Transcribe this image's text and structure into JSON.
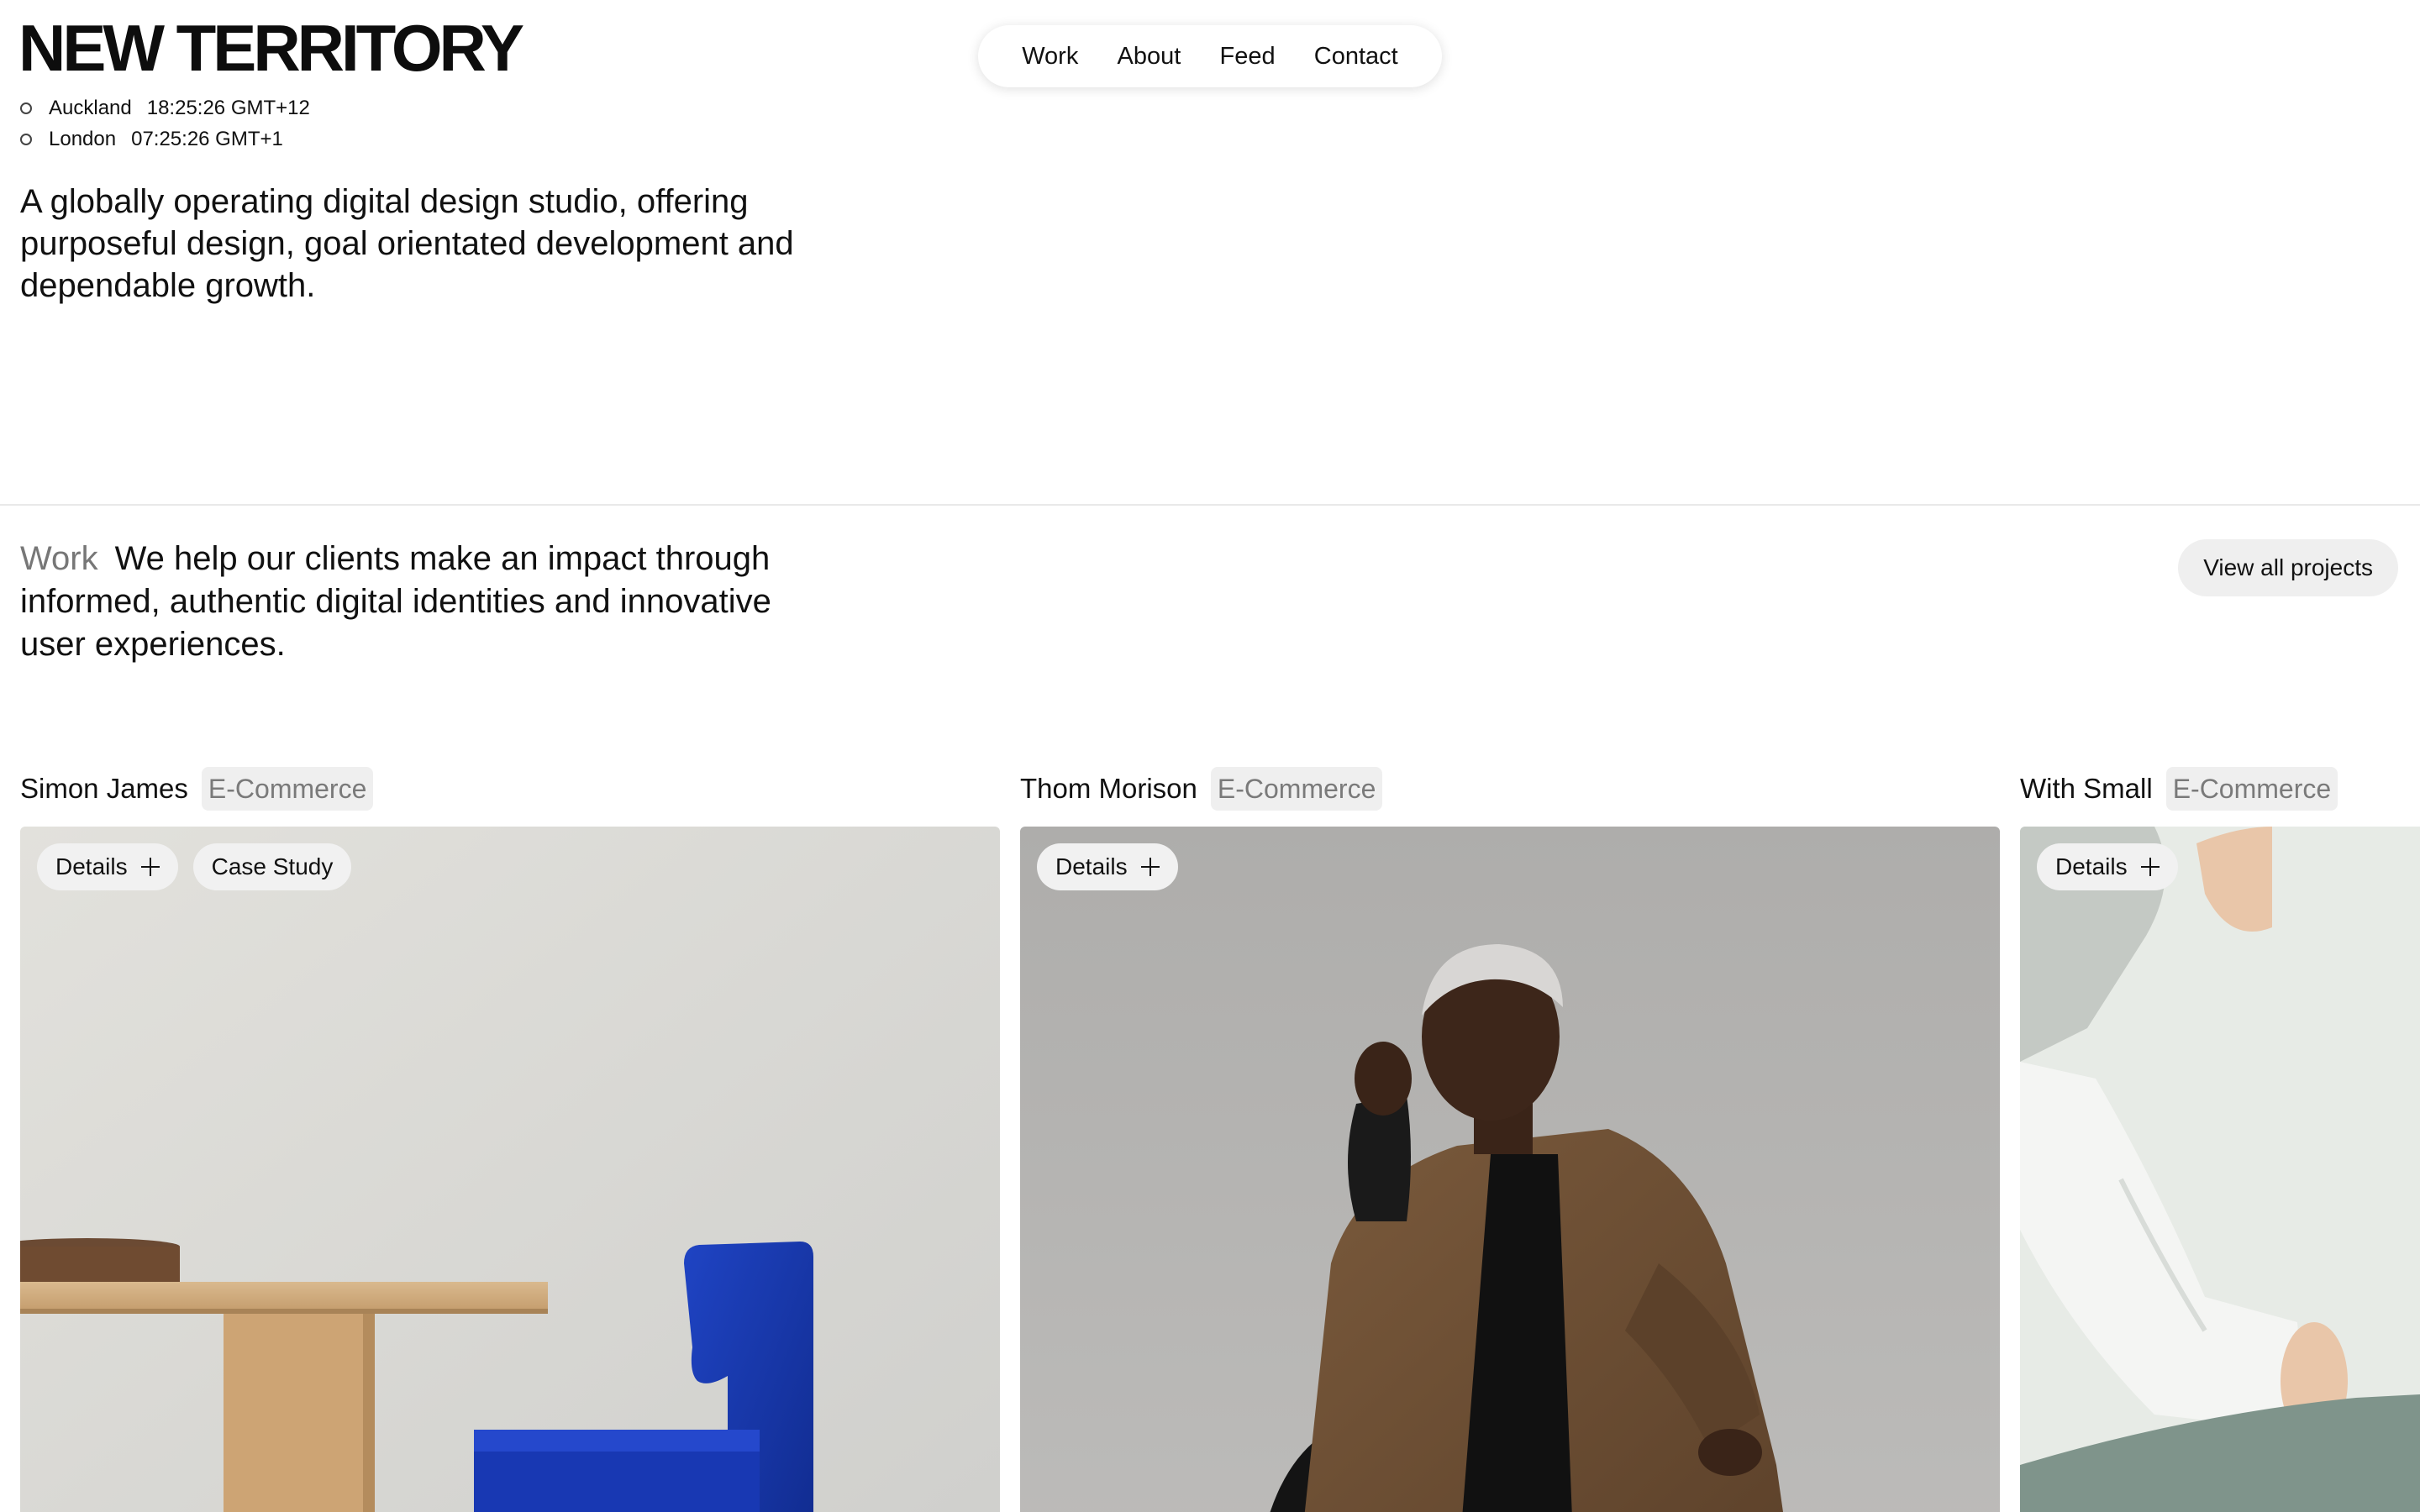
{
  "brand": {
    "logo": "NEW TERRITORY"
  },
  "clocks": [
    {
      "city": "Auckland",
      "time": "18:25:26 GMT+12"
    },
    {
      "city": "London",
      "time": "07:25:26 GMT+1"
    }
  ],
  "nav": {
    "items": [
      {
        "label": "Work"
      },
      {
        "label": "About"
      },
      {
        "label": "Feed"
      },
      {
        "label": "Contact"
      }
    ]
  },
  "hero": {
    "intro": "A globally operating digital design studio, offering purposeful design, goal orientated development and dependable growth."
  },
  "work": {
    "label": "Work",
    "description": "We help our clients make an impact through informed, authentic digital identities and innovative user experiences.",
    "view_all_label": "View all projects"
  },
  "projects": [
    {
      "name": "Simon James",
      "tag": "E-Commerce",
      "details_label": "Details",
      "case_study_label": "Case Study"
    },
    {
      "name": "Thom Morison",
      "tag": "E-Commerce",
      "details_label": "Details"
    },
    {
      "name": "With Small",
      "tag": "E-Commerce",
      "details_label": "Details"
    }
  ],
  "colors": {
    "text": "#111111",
    "muted": "#777777",
    "pill_bg": "#efefef",
    "chair_blue": "#1a3bb0"
  }
}
